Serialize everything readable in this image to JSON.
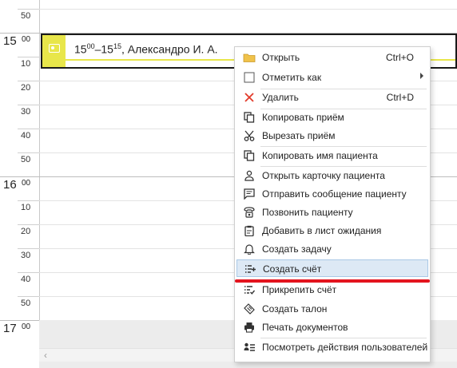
{
  "calendar": {
    "hours": [
      "15",
      "16",
      "17"
    ],
    "hour_superscript": "00",
    "minute_labels": [
      "50",
      "10",
      "20",
      "30",
      "40",
      "50",
      "10",
      "20",
      "30",
      "40",
      "50"
    ]
  },
  "appointment": {
    "start_h": "15",
    "start_m": "00",
    "dash": "–",
    "end_h": "15",
    "end_m": "15",
    "patient": ", Александро И. А.",
    "color": "#e8e64a"
  },
  "menu": {
    "items": [
      {
        "label": "Открыть",
        "shortcut": "Ctrl+O",
        "icon": "folder-icon"
      },
      {
        "label": "Отметить как",
        "icon": "checkbox-icon",
        "submenu": true
      },
      {
        "label": "Удалить",
        "shortcut": "Ctrl+D",
        "icon": "close-icon",
        "color": "#e23a2a"
      },
      {
        "label": "Копировать приём",
        "icon": "copy-icon"
      },
      {
        "label": "Вырезать приём",
        "icon": "scissors-icon"
      },
      {
        "label": "Копировать имя пациента",
        "icon": "copy-icon"
      },
      {
        "label": "Открыть карточку пациента",
        "icon": "person-icon"
      },
      {
        "label": "Отправить сообщение пациенту",
        "icon": "message-icon"
      },
      {
        "label": "Позвонить пациенту",
        "icon": "phone-icon"
      },
      {
        "label": "Добавить в лист ожидания",
        "icon": "clipboard-icon"
      },
      {
        "label": "Создать задачу",
        "icon": "bell-icon"
      },
      {
        "label": "Создать счёт",
        "icon": "invoice-add-icon",
        "highlighted": true
      },
      {
        "label": "Прикрепить счёт",
        "icon": "invoice-attach-icon"
      },
      {
        "label": "Создать талон",
        "icon": "ticket-icon"
      },
      {
        "label": "Печать документов",
        "icon": "printer-icon"
      },
      {
        "label": "Посмотреть действия пользователей",
        "icon": "user-list-icon"
      }
    ]
  },
  "highlight_color": "#dde9f5",
  "annotation_color": "#e3141e"
}
